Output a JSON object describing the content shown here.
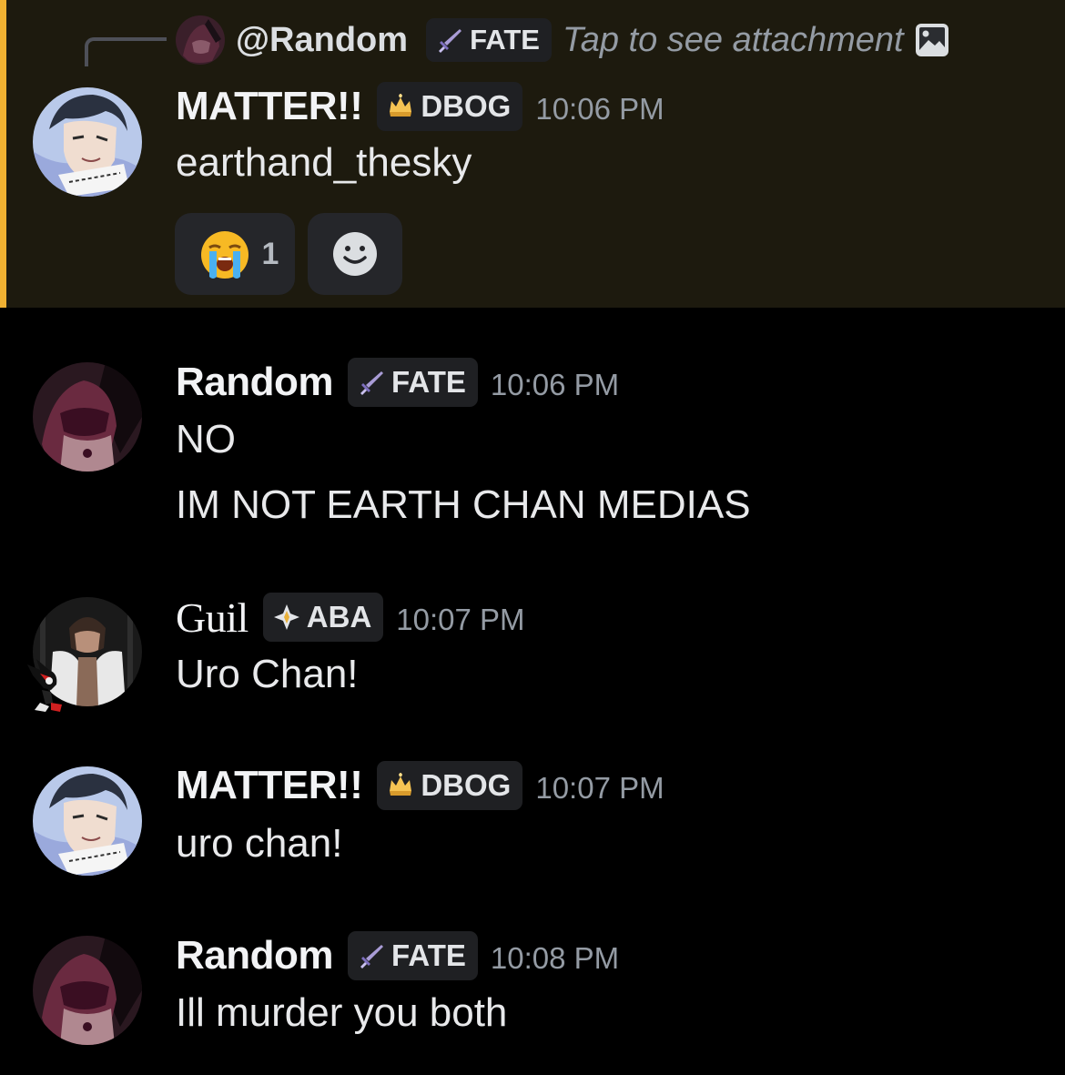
{
  "reply": {
    "name": "@Random",
    "tag": "FATE",
    "text": "Tap to see attachment",
    "icon": "image-attachment-icon"
  },
  "messages": [
    {
      "author": "MATTER!!",
      "tag": "DBOG",
      "tag_icon": "crown-flame-icon",
      "time": "10:06 PM",
      "lines": [
        "earthand_thesky"
      ],
      "reactions": [
        {
          "emoji": "loudly-crying-face",
          "count": "1"
        }
      ],
      "highlighted": true
    },
    {
      "author": "Random",
      "tag": "FATE",
      "tag_icon": "sword-icon",
      "time": "10:06 PM",
      "lines": [
        "NO",
        "IM NOT EARTH CHAN MEDIAS"
      ]
    },
    {
      "author": "Guil",
      "tag": "ABA",
      "tag_icon": "sparkle-diamond-icon",
      "time": "10:07 PM",
      "lines": [
        "Uro Chan!"
      ]
    },
    {
      "author": "MATTER!!",
      "tag": "DBOG",
      "tag_icon": "crown-flame-icon",
      "time": "10:07 PM",
      "lines": [
        "uro chan!"
      ]
    },
    {
      "author": "Random",
      "tag": "FATE",
      "tag_icon": "sword-icon",
      "time": "10:08 PM",
      "lines": [
        "Ill murder you both"
      ]
    }
  ],
  "colors": {
    "background": "#000000",
    "highlight_bg": "#1d1a0e",
    "highlight_bar": "#f0b132"
  }
}
